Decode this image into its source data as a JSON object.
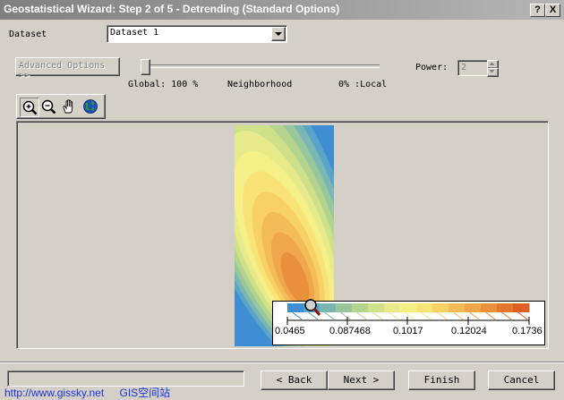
{
  "window": {
    "title": "Geostatistical Wizard: Step 2 of 5 - Detrending (Standard Options)",
    "help_label": "?",
    "close_label": "X"
  },
  "dataset": {
    "label": "Dataset",
    "value": "Dataset 1"
  },
  "advanced_options": {
    "label": "Advanced Options >>"
  },
  "slider": {
    "global_label": "Global: 100 %",
    "neighborhood_label": "Neighborhood",
    "local_label": "0% :Local",
    "value": 1.0
  },
  "power": {
    "label": "Power:",
    "value": "2"
  },
  "toolbar": {
    "tools": [
      {
        "name": "zoom-in-icon"
      },
      {
        "name": "zoom-out-icon"
      },
      {
        "name": "pan-hand-icon"
      },
      {
        "name": "globe-icon"
      }
    ]
  },
  "legend": {
    "colors": [
      "#3d8ed3",
      "#5aa4c8",
      "#79b6b4",
      "#98c69d",
      "#b4d48e",
      "#cfe08a",
      "#e6ea8a",
      "#f4ef86",
      "#f8e476",
      "#f7d066",
      "#f4bc58",
      "#f0a64a",
      "#ea8f3c",
      "#e4772f",
      "#de5f24"
    ],
    "tick_labels": [
      "0.0465",
      "0.087468",
      "0.1017",
      "0.12024",
      "0.1736"
    ],
    "tick_values": [
      0.0465,
      0.087468,
      0.1017,
      0.12024,
      0.1736
    ]
  },
  "buttons": {
    "back": "< Back",
    "next": "Next >",
    "finish": "Finish",
    "cancel": "Cancel"
  },
  "watermark": {
    "url": "http://www.gissky.net",
    "site": "GIS空间站"
  }
}
